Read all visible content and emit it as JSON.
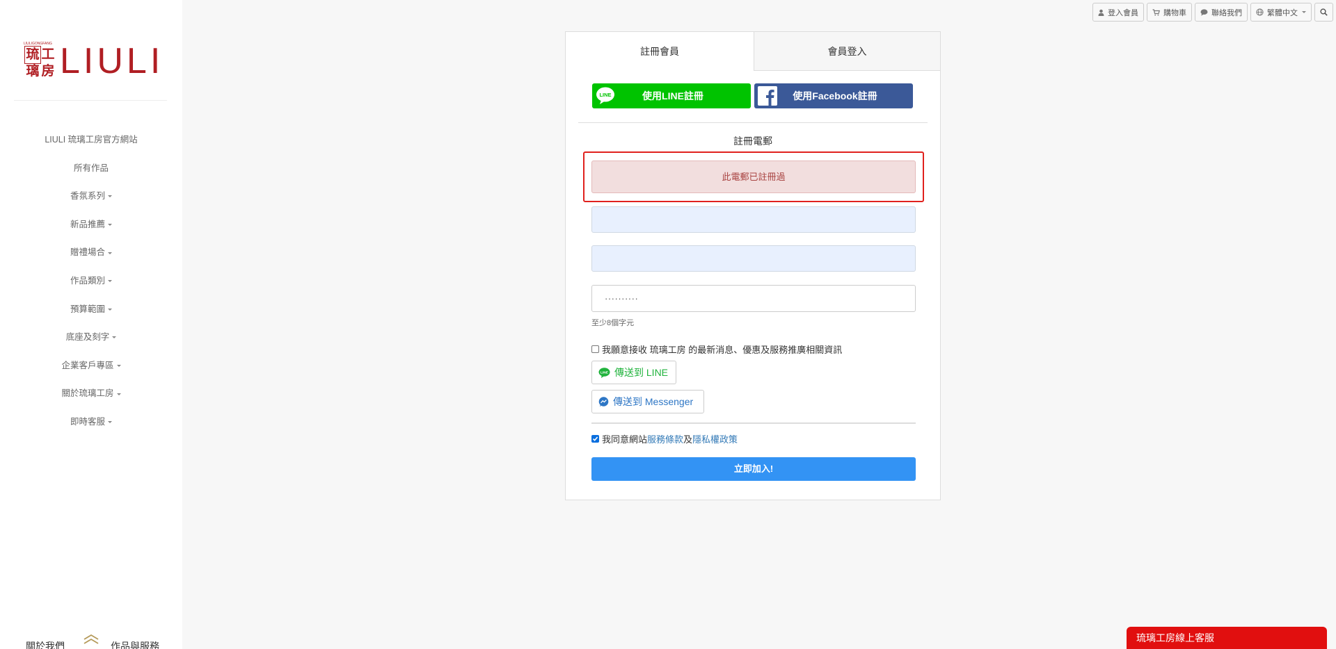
{
  "brand": {
    "small_text": "LIULIGONGFANG",
    "seal_chars": [
      "琉",
      "工",
      "璃",
      "房"
    ],
    "wordmark": "LIULI",
    "color": "#b01e23"
  },
  "sidebar": {
    "nav": [
      {
        "label": "LIULI 琉璃工房官方網站",
        "has_caret": false
      },
      {
        "label": "所有作品",
        "has_caret": false
      },
      {
        "label": "香氛系列",
        "has_caret": true
      },
      {
        "label": "新品推薦",
        "has_caret": true
      },
      {
        "label": "贈禮場合",
        "has_caret": true
      },
      {
        "label": "作品類別",
        "has_caret": true
      },
      {
        "label": "預算範圍",
        "has_caret": true
      },
      {
        "label": "底座及刻字",
        "has_caret": true
      },
      {
        "label": "企業客戶專區",
        "has_caret": true
      },
      {
        "label": "關於琉璃工房",
        "has_caret": true
      },
      {
        "label": "即時客服",
        "has_caret": true
      }
    ],
    "bottom_left": "關於我們",
    "bottom_right": "作品與服務"
  },
  "topbar": {
    "login": "登入會員",
    "cart": "購物車",
    "contact": "聯絡我們",
    "language": "繁體中文"
  },
  "form": {
    "tab_register": "註冊會員",
    "tab_login": "會員登入",
    "line_button": "使用LINE註冊",
    "facebook_button": "使用Facebook註冊",
    "email_label": "註冊電郵",
    "error_message": "此電郵已註冊過",
    "password_value": "··········",
    "password_hint": "至少8個字元",
    "newsletter_label": "我願意接收 琉璃工房 的最新消息、優惠及服務推廣相關資訊",
    "send_line": "傳送到 LINE",
    "send_messenger": "傳送到 Messenger",
    "agree_prefix": "我同意網站",
    "terms_link": "服務條款",
    "agree_and": "及",
    "privacy_link": "隱私權政策",
    "submit": "立即加入!"
  },
  "colors": {
    "line_green": "#00c300",
    "facebook_blue": "#3b5998",
    "submit_blue": "#3393f4",
    "error_bg": "#f2dede",
    "error_text": "#a94442",
    "chat_red": "#e10f0f"
  },
  "icons": {
    "user": "user-icon",
    "cart": "cart-icon",
    "contact": "chat-bubble-icon",
    "language": "globe-icon",
    "search": "search-icon"
  },
  "chat_widget": {
    "label": "琉璃工房線上客服"
  }
}
